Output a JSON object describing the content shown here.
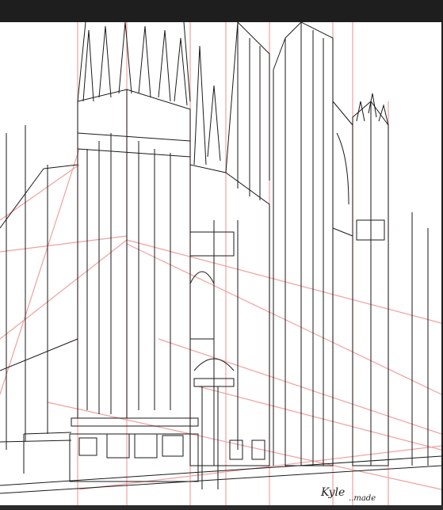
{
  "window": {
    "background": "#1e1e1e"
  },
  "canvas": {
    "background": "#ffffff",
    "line_color": "#1a1a1a",
    "guide_color": "#f0a0a0"
  },
  "artwork": {
    "subject": "gothic-cathedral-perspective-sketch",
    "signature_name": "Kyle",
    "signature_text": "..made"
  }
}
